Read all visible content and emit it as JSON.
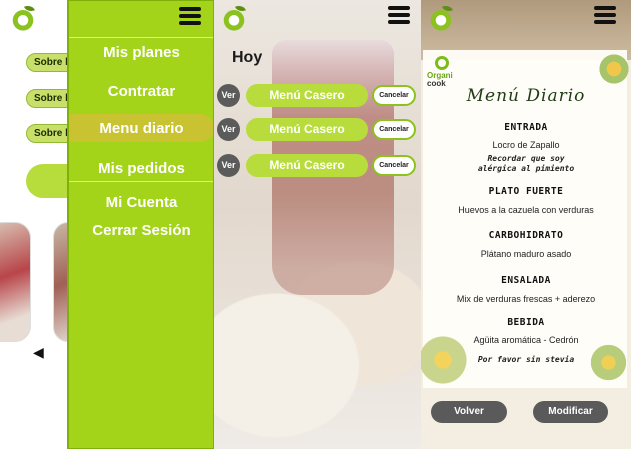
{
  "panel1": {
    "pills": [
      "Sobre l",
      "Sobre l",
      "Sobre l"
    ],
    "nav_arrow": "◀"
  },
  "side_menu": {
    "items": [
      "Mis planes",
      "Contratar",
      "Menu diario",
      "Mis pedidos",
      "Mi Cuenta",
      "Cerrar Sesión"
    ],
    "active_index": 2
  },
  "today": {
    "title": "Hoy",
    "rows": [
      {
        "view": "Ver",
        "name": "Menú Casero",
        "cancel": "Cancelar"
      },
      {
        "view": "Ver",
        "name": "Menú Casero",
        "cancel": "Cancelar"
      },
      {
        "view": "Ver",
        "name": "Menú Casero",
        "cancel": "Cancelar"
      }
    ]
  },
  "daily_menu": {
    "brand_line1": "Organi",
    "brand_line2": "cook",
    "title": "Menú Diario",
    "sections": [
      {
        "heading": "ENTRADA",
        "item": "Locro de Zapallo",
        "note": "Recordar que soy alérgica al pimiento"
      },
      {
        "heading": "PLATO FUERTE",
        "item": "Huevos a la cazuela con verduras"
      },
      {
        "heading": "CARBOHIDRATO",
        "item": "Plátano maduro asado"
      },
      {
        "heading": "ENSALADA",
        "item": "Mix de verduras frescas + aderezo"
      },
      {
        "heading": "BEBIDA",
        "item": "Agüita aromática - Cedrón",
        "note": "Por favor sin stevia"
      }
    ],
    "back_label": "Volver",
    "edit_label": "Modificar"
  },
  "colors": {
    "brand_green": "#a4d41a",
    "pill_green": "#b8dc3c",
    "dark_button": "#5a5a5a"
  },
  "icons": [
    "app-logo-icon",
    "hamburger-menu-icon",
    "arrow-left-icon"
  ]
}
